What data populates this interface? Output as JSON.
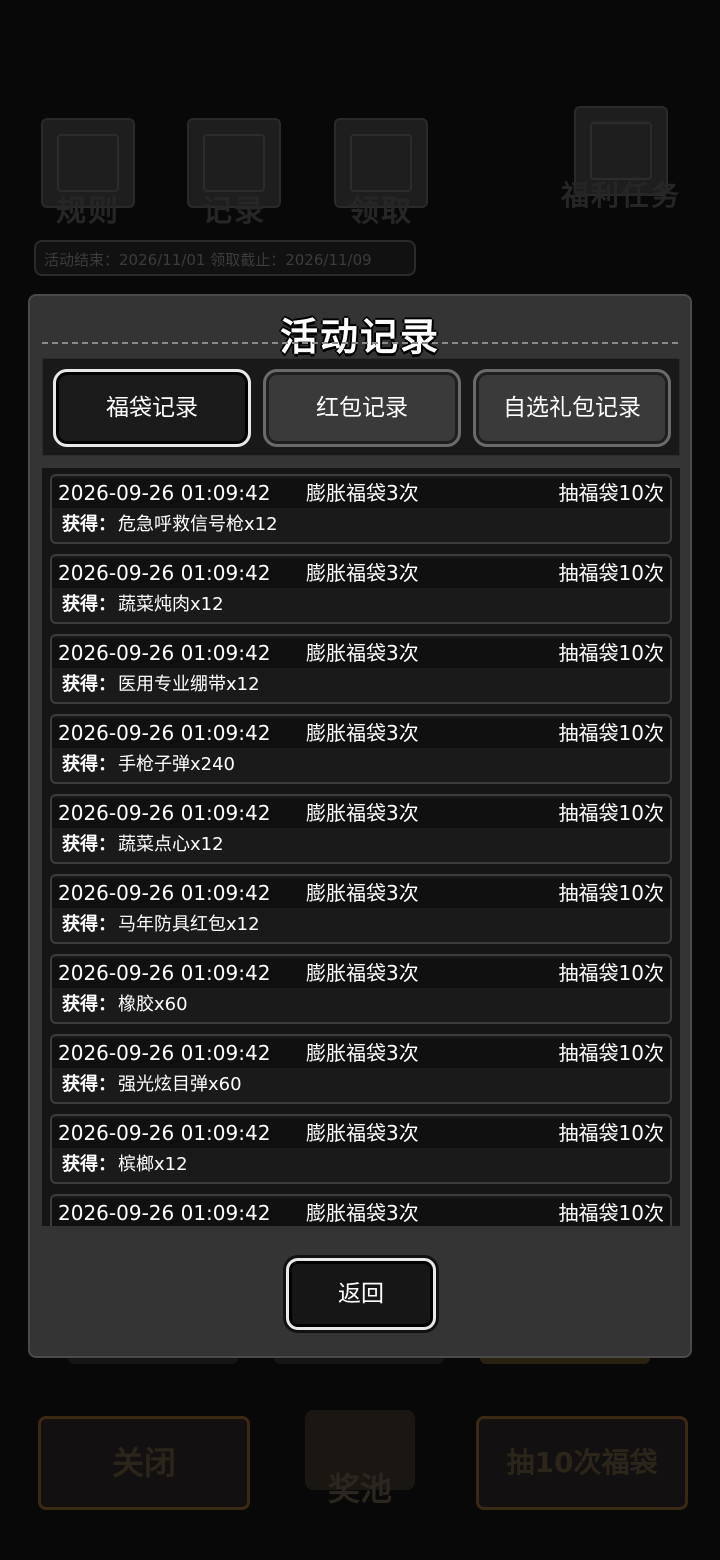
{
  "background": {
    "icons": [
      "规则",
      "记录",
      "领取",
      "福利任务"
    ],
    "dates": "活动结束：2026/11/01  领取截止：2026/11/09",
    "close_label": "关闭",
    "pool_label": "奖池",
    "draw10_label": "抽10次福袋"
  },
  "modal": {
    "title": "活动记录",
    "tabs": [
      {
        "label": "福袋记录",
        "active": true
      },
      {
        "label": "红包记录",
        "active": false
      },
      {
        "label": "自选礼包记录",
        "active": false
      }
    ],
    "obtained_label": "获得：",
    "records": [
      {
        "time": "2026-09-26 01:09:42",
        "type": "膨胀福袋3次",
        "action": "抽福袋10次",
        "reward": "危急呼救信号枪x12"
      },
      {
        "time": "2026-09-26 01:09:42",
        "type": "膨胀福袋3次",
        "action": "抽福袋10次",
        "reward": "蔬菜炖肉x12"
      },
      {
        "time": "2026-09-26 01:09:42",
        "type": "膨胀福袋3次",
        "action": "抽福袋10次",
        "reward": "医用专业绷带x12"
      },
      {
        "time": "2026-09-26 01:09:42",
        "type": "膨胀福袋3次",
        "action": "抽福袋10次",
        "reward": "手枪子弹x240"
      },
      {
        "time": "2026-09-26 01:09:42",
        "type": "膨胀福袋3次",
        "action": "抽福袋10次",
        "reward": "蔬菜点心x12"
      },
      {
        "time": "2026-09-26 01:09:42",
        "type": "膨胀福袋3次",
        "action": "抽福袋10次",
        "reward": "马年防具红包x12"
      },
      {
        "time": "2026-09-26 01:09:42",
        "type": "膨胀福袋3次",
        "action": "抽福袋10次",
        "reward": "橡胶x60"
      },
      {
        "time": "2026-09-26 01:09:42",
        "type": "膨胀福袋3次",
        "action": "抽福袋10次",
        "reward": "强光炫目弹x60"
      },
      {
        "time": "2026-09-26 01:09:42",
        "type": "膨胀福袋3次",
        "action": "抽福袋10次",
        "reward": "槟榔x12"
      },
      {
        "time": "2026-09-26 01:09:42",
        "type": "膨胀福袋3次",
        "action": "抽福袋10次",
        "reward": ""
      }
    ],
    "back_label": "返回"
  }
}
